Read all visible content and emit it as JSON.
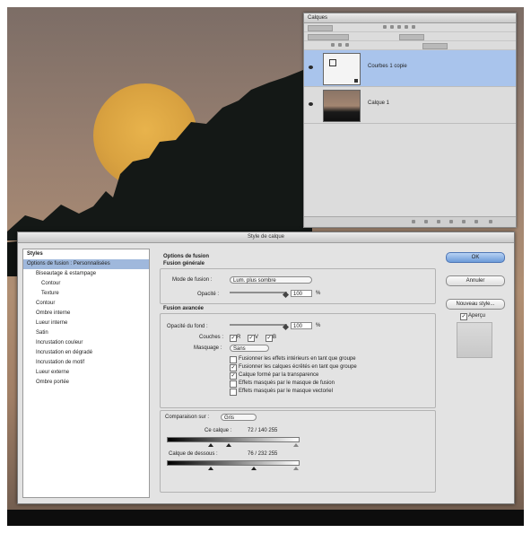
{
  "layers_panel": {
    "title": "Calques",
    "layers": [
      {
        "name": "Courbes 1 copie",
        "selected": true
      },
      {
        "name": "Calque 1",
        "selected": false
      }
    ]
  },
  "dialog": {
    "title": "Style de calque",
    "styles_list": [
      {
        "label": "Styles",
        "kind": "header"
      },
      {
        "label": "Options de fusion : Personnalisées",
        "kind": "selected"
      },
      {
        "label": "Biseautage & estampage",
        "kind": "normal"
      },
      {
        "label": "Contour",
        "kind": "indent"
      },
      {
        "label": "Texture",
        "kind": "indent"
      },
      {
        "label": "Contour",
        "kind": "normal"
      },
      {
        "label": "Ombre interne",
        "kind": "normal"
      },
      {
        "label": "Lueur interne",
        "kind": "normal"
      },
      {
        "label": "Satin",
        "kind": "normal"
      },
      {
        "label": "Incrustation couleur",
        "kind": "normal"
      },
      {
        "label": "Incrustation en dégradé",
        "kind": "normal"
      },
      {
        "label": "Incrustation de motif",
        "kind": "normal"
      },
      {
        "label": "Lueur externe",
        "kind": "normal"
      },
      {
        "label": "Ombre portée",
        "kind": "normal"
      }
    ],
    "options": {
      "section_title": "Options de fusion",
      "general_title": "Fusion générale",
      "mode_label": "Mode de fusion :",
      "mode_value": "Lum. plus sombre",
      "opacity_label": "Opacité :",
      "opacity_value": "100",
      "opacity_unit": "%",
      "advanced_title": "Fusion avancée",
      "fill_opacity_label": "Opacité du fond :",
      "fill_opacity_value": "100",
      "fill_opacity_unit": "%",
      "channels_label": "Couches :",
      "channels": [
        "R",
        "V",
        "B"
      ],
      "knockout_label": "Masquage :",
      "knockout_value": "Sans",
      "checkboxes": [
        {
          "label": "Fusionner les effets intérieurs en tant que groupe",
          "checked": false
        },
        {
          "label": "Fusionner les calques écrêtés en tant que groupe",
          "checked": true
        },
        {
          "label": "Calque formé par la transparence",
          "checked": true
        },
        {
          "label": "Effets masqués par le masque de fusion",
          "checked": false
        },
        {
          "label": "Effets masqués par le masque vectoriel",
          "checked": false
        }
      ],
      "blend_if_label": "Comparaison sur :",
      "blend_if_value": "Gris",
      "this_layer_label": "Ce calque :",
      "this_layer_values": "72 / 140   255",
      "underlying_label": "Calque de dessous :",
      "underlying_values": "76 / 232   255"
    },
    "buttons": {
      "ok": "OK",
      "cancel": "Annuler",
      "new_style": "Nouveau style...",
      "preview": "Aperçu"
    }
  }
}
